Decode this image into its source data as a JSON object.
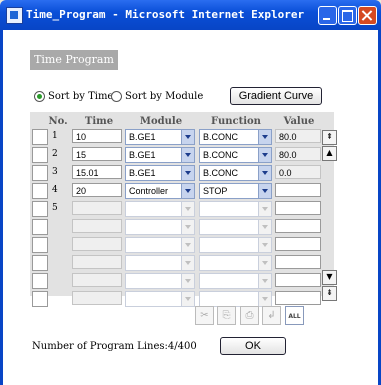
{
  "window": {
    "title": "Time_Program - Microsoft Internet Explorer"
  },
  "panel": {
    "tag": "Time Program"
  },
  "sort": {
    "by_time": "Sort by Time",
    "by_module": "Sort by Module",
    "selected": "by_time"
  },
  "buttons": {
    "gradient_curve": "Gradient Curve",
    "ok": "OK"
  },
  "columns": {
    "no": "No.",
    "time": "Time",
    "module": "Module",
    "function": "Function",
    "value": "Value"
  },
  "rows": [
    {
      "no": "1",
      "time": "10",
      "module": "B.GE1",
      "function": "B.CONC",
      "value": "80.0"
    },
    {
      "no": "2",
      "time": "15",
      "module": "B.GE1",
      "function": "B.CONC",
      "value": "80.0"
    },
    {
      "no": "3",
      "time": "15.01",
      "module": "B.GE1",
      "function": "B.CONC",
      "value": "0.0"
    },
    {
      "no": "4",
      "time": "20",
      "module": "Controller",
      "function": "STOP",
      "value": ""
    },
    {
      "no": "5",
      "time": "",
      "module": "",
      "function": "",
      "value": ""
    },
    {
      "no": "",
      "time": "",
      "module": "",
      "function": "",
      "value": ""
    },
    {
      "no": "",
      "time": "",
      "module": "",
      "function": "",
      "value": ""
    },
    {
      "no": "",
      "time": "",
      "module": "",
      "function": "",
      "value": ""
    },
    {
      "no": "",
      "time": "",
      "module": "",
      "function": "",
      "value": ""
    },
    {
      "no": "",
      "time": "",
      "module": "",
      "function": "",
      "value": ""
    }
  ],
  "toolbar": [
    "cut-icon",
    "copy-icon",
    "paste-icon",
    "insert-icon",
    "clear-all-icon"
  ],
  "toolbar_all": "ALL",
  "footer": {
    "program_lines": "Number of Program Lines:4/400"
  }
}
